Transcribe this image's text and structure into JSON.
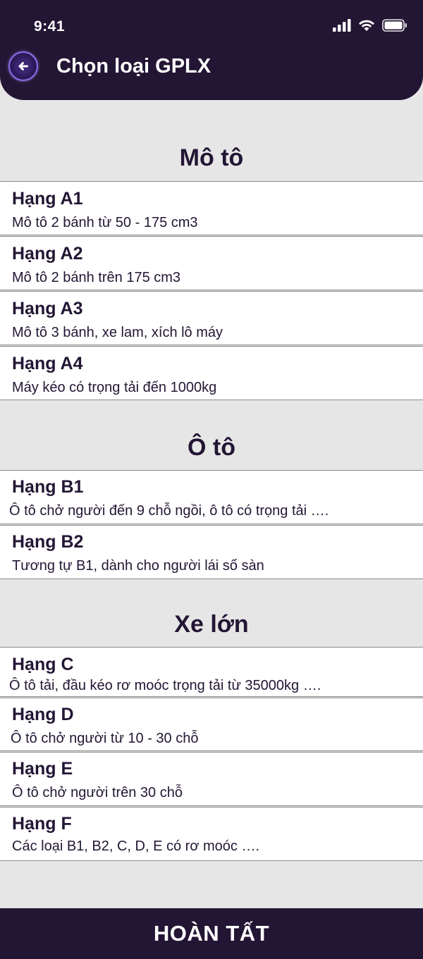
{
  "status_bar": {
    "time": "9:41"
  },
  "header": {
    "title": "Chọn loại GPLX"
  },
  "sections": [
    {
      "title": "Mô tô",
      "items": [
        {
          "name": "Hạng A1",
          "desc": "Mô tô 2 bánh từ 50 - 175 cm3"
        },
        {
          "name": "Hạng A2",
          "desc": "Mô tô 2 bánh trên 175 cm3"
        },
        {
          "name": "Hạng A3",
          "desc": "Mô tô 3 bánh, xe lam, xích lô máy"
        },
        {
          "name": "Hạng A4",
          "desc": "Máy kéo có trọng tải đến 1000kg"
        }
      ]
    },
    {
      "title": "Ô tô",
      "items": [
        {
          "name": "Hạng B1",
          "desc": "Ô tô chở người đến 9 chỗ ngồi, ô tô có trọng tải …."
        },
        {
          "name": "Hạng B2",
          "desc": "Tương tự B1, dành cho người lái số sàn"
        }
      ]
    },
    {
      "title": "Xe lớn",
      "items": [
        {
          "name": "Hạng C",
          "desc": "Ô tô tải, đầu kéo rơ moóc trọng tải từ 35000kg …."
        },
        {
          "name": "Hạng D",
          "desc": "Ô tô chở người từ 10 - 30 chỗ"
        },
        {
          "name": "Hạng E",
          "desc": "Ô tô chở người trên 30 chỗ"
        },
        {
          "name": "Hạng F",
          "desc": "Các loại B1, B2, C, D, E có rơ moóc …."
        }
      ]
    }
  ],
  "footer": {
    "done_label": "HOÀN TẤT"
  },
  "colors": {
    "primary": "#231634",
    "background": "#e6e6e6",
    "card": "#ffffff",
    "back_ring": "#8b6cf0"
  },
  "icons": {
    "back": "arrow-left-icon",
    "signal": "cellular-signal-icon",
    "wifi": "wifi-icon",
    "battery": "battery-icon"
  }
}
